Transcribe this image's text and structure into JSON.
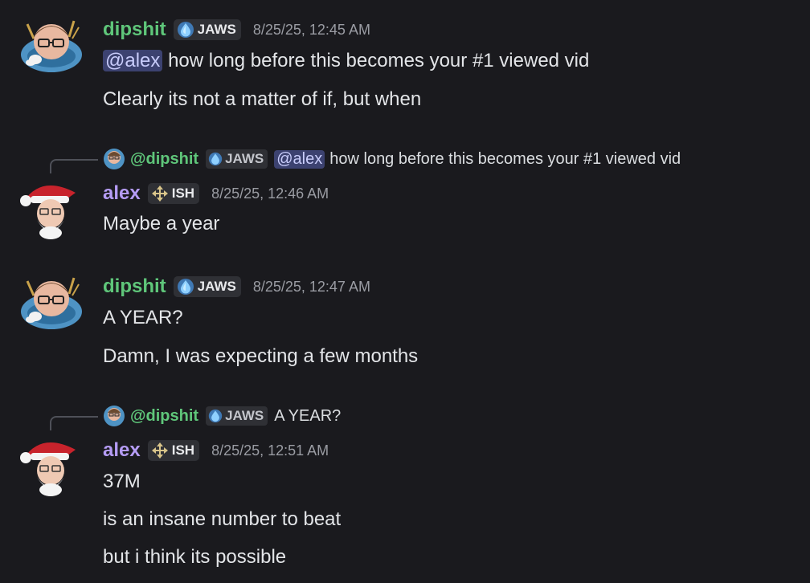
{
  "messages": [
    {
      "user": "dipshit",
      "tag": "JAWS",
      "tag_icon": "water-drop-icon",
      "avatar": "dipshit-avatar",
      "timestamp": "8/25/25, 12:45 AM",
      "mention": "@alex",
      "lines": [
        "how long before this becomes your #1 viewed vid",
        "Clearly its not a matter of if, but when"
      ]
    },
    {
      "reply": {
        "user": "@dipshit",
        "tag": "JAWS",
        "mention": "@alex",
        "text": "how long before this becomes your #1 viewed vid"
      },
      "user": "alex",
      "tag": "ISH",
      "tag_icon": "diamond-arrows-icon",
      "avatar": "alex-santa-avatar",
      "timestamp": "8/25/25, 12:46 AM",
      "lines": [
        "Maybe a year"
      ]
    },
    {
      "user": "dipshit",
      "tag": "JAWS",
      "tag_icon": "water-drop-icon",
      "avatar": "dipshit-avatar",
      "timestamp": "8/25/25, 12:47 AM",
      "lines": [
        "A YEAR?",
        "Damn, I was expecting a few months"
      ]
    },
    {
      "reply": {
        "user": "@dipshit",
        "tag": "JAWS",
        "text": "A YEAR?"
      },
      "user": "alex",
      "tag": "ISH",
      "tag_icon": "diamond-arrows-icon",
      "avatar": "alex-santa-avatar",
      "timestamp": "8/25/25, 12:51 AM",
      "lines": [
        "37M",
        "is an insane number to beat",
        "but i think its possible"
      ]
    }
  ],
  "colors": {
    "background": "#1a1a1e",
    "dipshit_name": "#5fc67a",
    "alex_name": "#b59cf5",
    "mention_bg": "#3c4270",
    "mention_text": "#c9cdfb",
    "timestamp": "#9a9ca3"
  }
}
